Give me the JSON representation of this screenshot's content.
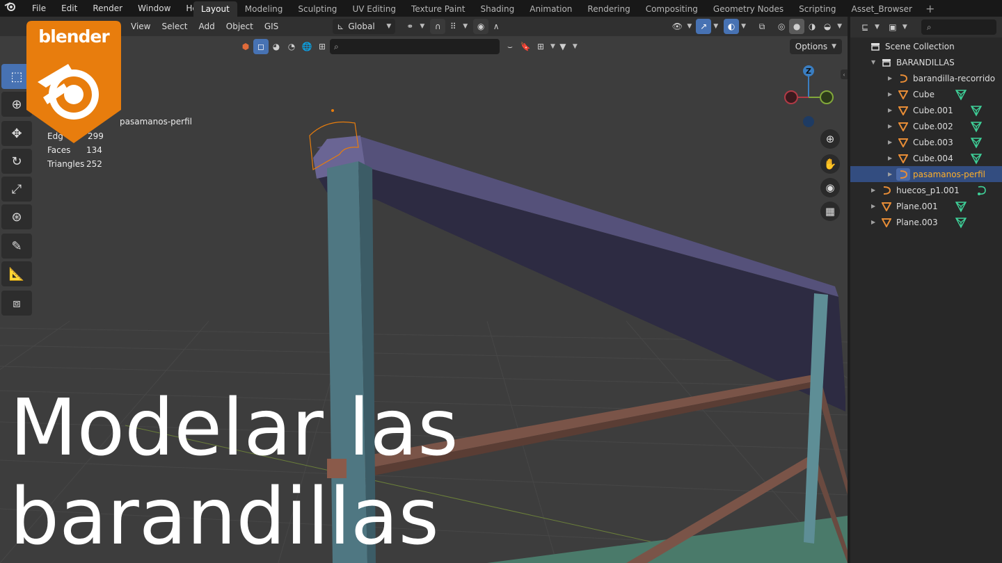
{
  "menubar": {
    "items": [
      "File",
      "Edit",
      "Render",
      "Window",
      "Help"
    ]
  },
  "workspaces": {
    "tabs": [
      "Layout",
      "Modeling",
      "Sculpting",
      "UV Editing",
      "Texture Paint",
      "Shading",
      "Animation",
      "Rendering",
      "Compositing",
      "Geometry Nodes",
      "Scripting",
      "Asset_Browser"
    ],
    "active": "Layout"
  },
  "viewport_header": {
    "menus": [
      "View",
      "Select",
      "Add",
      "Object",
      "GIS"
    ],
    "orientation": "Global",
    "options_label": "Options"
  },
  "stats": {
    "object_name": "pasamanos-perfil",
    "rows": [
      {
        "label": "Edg",
        "value": "299"
      },
      {
        "label": "Faces",
        "value": "134"
      },
      {
        "label": "Triangles",
        "value": "252"
      }
    ]
  },
  "gizmo": {
    "z_label": "Z"
  },
  "outliner": {
    "header": "Scene Collection",
    "collection": "BARANDILLAS",
    "items": [
      {
        "name": "barandilla-recorrido",
        "type": "curve",
        "data": ""
      },
      {
        "name": "Cube",
        "type": "mesh",
        "data": "mesh"
      },
      {
        "name": "Cube.001",
        "type": "mesh",
        "data": "mesh"
      },
      {
        "name": "Cube.002",
        "type": "mesh",
        "data": "mesh"
      },
      {
        "name": "Cube.003",
        "type": "mesh",
        "data": "mesh"
      },
      {
        "name": "Cube.004",
        "type": "mesh",
        "data": "mesh"
      },
      {
        "name": "pasamanos-perfil",
        "type": "curve",
        "data": ""
      },
      {
        "name": "huecos_p1.001",
        "type": "curve",
        "data": "curve"
      },
      {
        "name": "Plane.001",
        "type": "mesh",
        "data": "mesh"
      },
      {
        "name": "Plane.003",
        "type": "mesh",
        "data": "mesh"
      }
    ]
  },
  "logo": {
    "text": "blender"
  },
  "title": {
    "line1": "Modelar las",
    "line2": "barandillas"
  },
  "colors": {
    "accent_blue": "#4772b3",
    "selected_row": "#334d80",
    "orange": "#e87d0d",
    "selected_text": "#ffaf29",
    "mesh_icon": "#e88d36",
    "data_green": "#3fd39a"
  }
}
